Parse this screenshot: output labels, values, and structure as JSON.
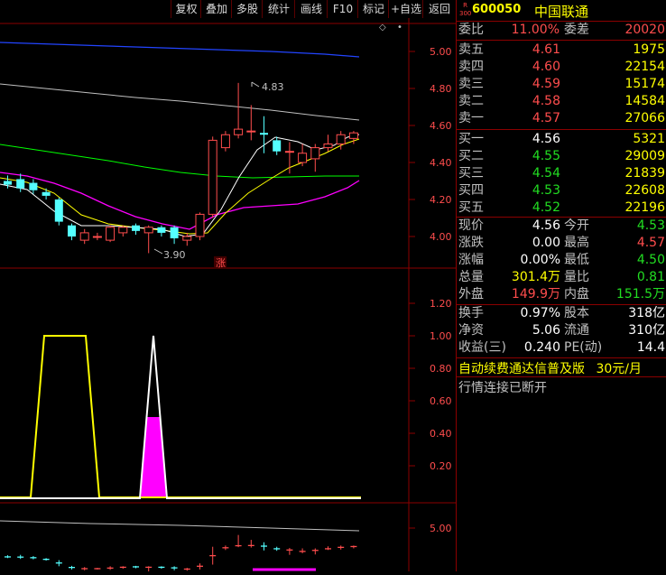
{
  "toolbar": [
    "复权",
    "叠加",
    "多股",
    "统计",
    "画线",
    "F10",
    "标记",
    "+自选",
    "返回"
  ],
  "stock": {
    "badge_top": "R",
    "badge_bottom": "300",
    "code": "600050",
    "name": "中国联通"
  },
  "weibi": {
    "label": "委比",
    "value": "11.00%",
    "label2": "委差",
    "value2": "20020"
  },
  "asks": [
    {
      "label": "卖五",
      "price": "4.61",
      "vol": "1975"
    },
    {
      "label": "卖四",
      "price": "4.60",
      "vol": "22154"
    },
    {
      "label": "卖三",
      "price": "4.59",
      "vol": "15174"
    },
    {
      "label": "卖二",
      "price": "4.58",
      "vol": "14584"
    },
    {
      "label": "卖一",
      "price": "4.57",
      "vol": "27066"
    }
  ],
  "bids": [
    {
      "label": "买一",
      "price": "4.56",
      "vol": "5321"
    },
    {
      "label": "买二",
      "price": "4.55",
      "vol": "29009"
    },
    {
      "label": "买三",
      "price": "4.54",
      "vol": "21839"
    },
    {
      "label": "买四",
      "price": "4.53",
      "vol": "22608"
    },
    {
      "label": "买五",
      "price": "4.52",
      "vol": "22196"
    }
  ],
  "quote": [
    {
      "l1": "现价",
      "v1": "4.56",
      "l2": "今开",
      "v2": "4.53"
    },
    {
      "l1": "涨跌",
      "v1": "0.00",
      "l2": "最高",
      "v2": "4.57"
    },
    {
      "l1": "涨幅",
      "v1": "0.00%",
      "l2": "最低",
      "v2": "4.50"
    },
    {
      "l1": "总量",
      "v1": "301.4万",
      "l2": "量比",
      "v2": "0.81"
    },
    {
      "l1": "外盘",
      "v1": "149.9万",
      "l2": "内盘",
      "v2": "151.5万"
    }
  ],
  "fundamentals": [
    {
      "l1": "换手",
      "v1": "0.97%",
      "l2": "股本",
      "v2": "318亿"
    },
    {
      "l1": "净资",
      "v1": "5.06",
      "l2": "流通",
      "v2": "310亿"
    },
    {
      "l1": "收益(三)",
      "v1": "0.240",
      "l2": "PE(动)",
      "v2": "14.4"
    }
  ],
  "ad_text": "自动续费通达信普及版",
  "ad_price": "30元/月",
  "status_text": "行情连接已断开",
  "main_axis": [
    "5.00",
    "4.80",
    "4.60",
    "4.40",
    "4.20",
    "4.00"
  ],
  "annot_high": "4.83",
  "annot_low": "3.90",
  "zhang_mark": "涨",
  "ind_axis": [
    "1.20",
    "1.00",
    "0.80",
    "0.60",
    "0.40",
    "0.20"
  ],
  "sub_axis": [
    "5.00"
  ],
  "colors": {
    "up": "#ff4d4d",
    "down": "#54ffff",
    "ma5": "#ffffff",
    "ma10": "#ffff00",
    "ma20": "#ff00ff",
    "ma60": "#00ff00",
    "ma120": "#c0c0c0",
    "ma250": "#2244ff"
  },
  "candles": [
    {
      "o": 4.3,
      "c": 4.28,
      "h": 4.33,
      "l": 4.26
    },
    {
      "o": 4.31,
      "c": 4.26,
      "h": 4.34,
      "l": 4.24
    },
    {
      "o": 4.29,
      "c": 4.25,
      "h": 4.31,
      "l": 4.23
    },
    {
      "o": 4.24,
      "c": 4.22,
      "h": 4.26,
      "l": 4.2
    },
    {
      "o": 4.2,
      "c": 4.08,
      "h": 4.21,
      "l": 4.06
    },
    {
      "o": 4.06,
      "c": 4.0,
      "h": 4.07,
      "l": 3.98
    },
    {
      "o": 3.98,
      "c": 4.02,
      "h": 4.04,
      "l": 3.96
    },
    {
      "o": 4.0,
      "c": 4.0,
      "h": 4.02,
      "l": 3.98
    },
    {
      "o": 3.98,
      "c": 4.05,
      "h": 4.06,
      "l": 3.97
    },
    {
      "o": 4.02,
      "c": 4.05,
      "h": 4.06,
      "l": 4.0
    },
    {
      "o": 4.06,
      "c": 4.03,
      "h": 4.07,
      "l": 4.01
    },
    {
      "o": 4.02,
      "c": 4.05,
      "h": 4.06,
      "l": 3.91
    },
    {
      "o": 4.05,
      "c": 4.02,
      "h": 4.06,
      "l": 4.0
    },
    {
      "o": 4.05,
      "c": 3.99,
      "h": 4.06,
      "l": 3.96
    },
    {
      "o": 3.98,
      "c": 4.0,
      "h": 4.02,
      "l": 3.95
    },
    {
      "o": 4.0,
      "c": 4.12,
      "h": 4.13,
      "l": 3.98
    },
    {
      "o": 4.12,
      "c": 4.52,
      "h": 4.54,
      "l": 4.1
    },
    {
      "o": 4.48,
      "c": 4.55,
      "h": 4.57,
      "l": 4.46
    },
    {
      "o": 4.55,
      "c": 4.58,
      "h": 4.83,
      "l": 4.53
    },
    {
      "o": 4.57,
      "c": 4.57,
      "h": 4.71,
      "l": 4.52
    },
    {
      "o": 4.56,
      "c": 4.55,
      "h": 4.65,
      "l": 4.45
    },
    {
      "o": 4.52,
      "c": 4.46,
      "h": 4.54,
      "l": 4.44
    },
    {
      "o": 4.46,
      "c": 4.46,
      "h": 4.51,
      "l": 4.34
    },
    {
      "o": 4.4,
      "c": 4.45,
      "h": 4.5,
      "l": 4.38
    },
    {
      "o": 4.42,
      "c": 4.48,
      "h": 4.5,
      "l": 4.35
    },
    {
      "o": 4.48,
      "c": 4.5,
      "h": 4.55,
      "l": 4.46
    },
    {
      "o": 4.5,
      "c": 4.55,
      "h": 4.57,
      "l": 4.47
    },
    {
      "o": 4.53,
      "c": 4.56,
      "h": 4.57,
      "l": 4.5
    }
  ]
}
